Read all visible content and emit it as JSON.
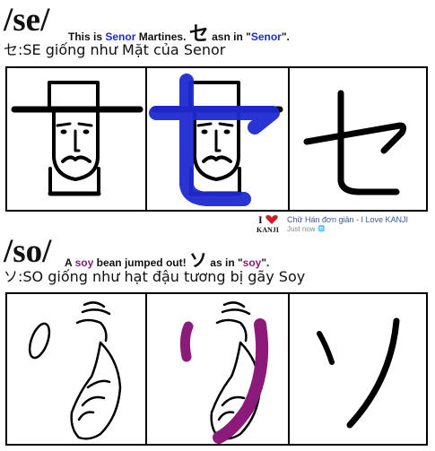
{
  "se_section": {
    "romaji": "/se/",
    "intro_1": "This is",
    "name_1": "Senor",
    "intro_2": "Martines.",
    "kana": "セ",
    "intro_3": "asn in \"",
    "name_2": "Senor",
    "intro_4": "\".",
    "viet": "セ:SE giống như Mặt của Senor"
  },
  "credit": {
    "logo_i": "I",
    "logo_kanji": "KANJI",
    "page_name": "Chữ Hán đơn giản - I Love KANJI",
    "time": "Just now"
  },
  "so_section": {
    "romaji": "/so/",
    "intro_1": "A",
    "word_1": "soy",
    "intro_2": "bean jumped out!",
    "kana": "ソ",
    "intro_3": "as in \"",
    "word_2": "soy",
    "intro_4": "\".",
    "viet": "ソ:SO giống như hạt đậu tương bị gãy Soy"
  },
  "colors": {
    "blue": "#1f2ad0",
    "purple": "#8c1a7a",
    "heart": "#d11a2a"
  }
}
